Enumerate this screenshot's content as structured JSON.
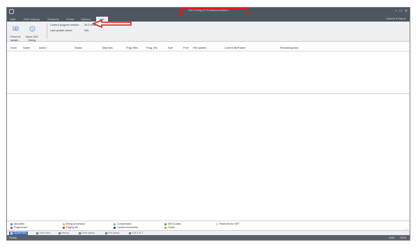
{
  "window": {
    "title": "O&O Defrag 20 Professional Edition"
  },
  "menu": {
    "tabs": [
      {
        "label": "Start",
        "active": false
      },
      {
        "label": "Disk cleanup",
        "active": false
      },
      {
        "label": "Schedule",
        "active": false
      },
      {
        "label": "Extras",
        "active": false
      },
      {
        "label": "Options",
        "active": false
      },
      {
        "label": "Info",
        "active": true
      }
    ],
    "right": "Options ▾  Help ▾"
  },
  "ribbon": {
    "check_updates_label": "Check for\nupdate...",
    "about_label": "About O&O\nDefrag",
    "current_version_label": "Current program version:",
    "current_version_value": "20.0.1061",
    "last_check_label": "Last update check:",
    "last_check_value": "N/A"
  },
  "table": {
    "columns": [
      "Drive",
      "Name",
      "Action",
      "Status",
      "Total files",
      "Frag. files",
      "Frag. (%)",
      "Size",
      "Free",
      "File system",
      "Current file/Folder",
      "Remaining time"
    ]
  },
  "legend": {
    "items": [
      {
        "label": "Allocated",
        "color": "#5b8fd6"
      },
      {
        "label": "Fragmented",
        "color": "#e0504a"
      },
      {
        "label": "Being processed",
        "color": "#f2c12e"
      },
      {
        "label": "Paging file",
        "color": "#a2558c"
      },
      {
        "label": "Compressed",
        "color": "#5fc6b4"
      },
      {
        "label": "Locked exclusively",
        "color": "#555555"
      },
      {
        "label": "META-Data",
        "color": "#56b84a"
      },
      {
        "label": "Folder",
        "color": "#f0a03a"
      },
      {
        "label": "Reserved for MFT",
        "color": "#d8d8d8"
      }
    ]
  },
  "view_tabs": [
    {
      "label": "ClusterView",
      "active": true
    },
    {
      "label": "Time view",
      "active": false
    },
    {
      "label": "History",
      "active": false
    },
    {
      "label": "Drive status",
      "active": false
    },
    {
      "label": "File status",
      "active": false
    },
    {
      "label": "S.M.A.R.T.",
      "active": false
    }
  ],
  "status": {
    "left": "Ready",
    "right_items": [
      "NUM",
      "SCRL"
    ]
  },
  "colors": {
    "titlebar": "#4e5660",
    "ribbon": "#eef0f3",
    "accent": "#3b6fb6",
    "annotation": "#e0191b"
  }
}
